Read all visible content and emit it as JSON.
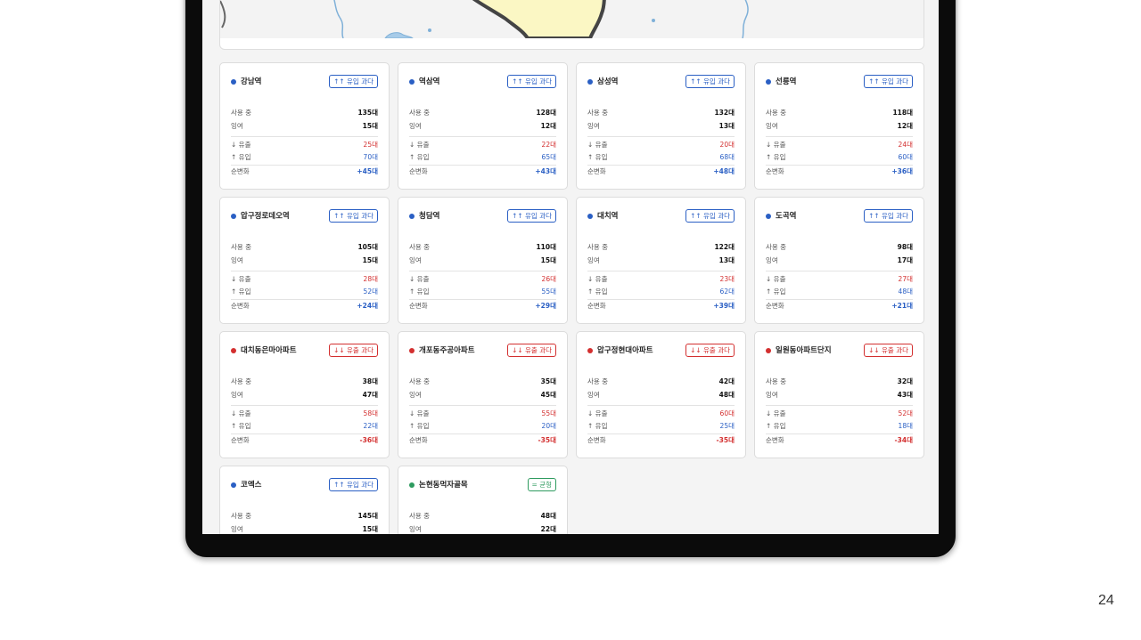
{
  "page_number": "24",
  "colors": {
    "inflow": "#2a5fc4",
    "outflow": "#d32f2f",
    "balanced": "#2e9b5f"
  },
  "labels": {
    "in_use": "사용 중",
    "spare": "잉여",
    "outflow": "↓ 유출",
    "inflow": "↑ 유입",
    "net": "순변화"
  },
  "stations": [
    {
      "name": "강남역",
      "status": "up",
      "badge": "↑↑ 유입 과다",
      "in_use": "135대",
      "spare": "15대",
      "outflow": "25대",
      "inflow": "70대",
      "net": "+45대"
    },
    {
      "name": "역삼역",
      "status": "up",
      "badge": "↑↑ 유입 과다",
      "in_use": "128대",
      "spare": "12대",
      "outflow": "22대",
      "inflow": "65대",
      "net": "+43대"
    },
    {
      "name": "삼성역",
      "status": "up",
      "badge": "↑↑ 유입 과다",
      "in_use": "132대",
      "spare": "13대",
      "outflow": "20대",
      "inflow": "68대",
      "net": "+48대"
    },
    {
      "name": "선릉역",
      "status": "up",
      "badge": "↑↑ 유입 과다",
      "in_use": "118대",
      "spare": "12대",
      "outflow": "24대",
      "inflow": "60대",
      "net": "+36대"
    },
    {
      "name": "압구정로데오역",
      "status": "up",
      "badge": "↑↑ 유입 과다",
      "in_use": "105대",
      "spare": "15대",
      "outflow": "28대",
      "inflow": "52대",
      "net": "+24대"
    },
    {
      "name": "청담역",
      "status": "up",
      "badge": "↑↑ 유입 과다",
      "in_use": "110대",
      "spare": "15대",
      "outflow": "26대",
      "inflow": "55대",
      "net": "+29대"
    },
    {
      "name": "대치역",
      "status": "up",
      "badge": "↑↑ 유입 과다",
      "in_use": "122대",
      "spare": "13대",
      "outflow": "23대",
      "inflow": "62대",
      "net": "+39대"
    },
    {
      "name": "도곡역",
      "status": "up",
      "badge": "↑↑ 유입 과다",
      "in_use": "98대",
      "spare": "17대",
      "outflow": "27대",
      "inflow": "48대",
      "net": "+21대"
    },
    {
      "name": "대치동은마아파트",
      "status": "down",
      "badge": "↓↓ 유출 과다",
      "in_use": "38대",
      "spare": "47대",
      "outflow": "58대",
      "inflow": "22대",
      "net": "-36대"
    },
    {
      "name": "개포동주공아파트",
      "status": "down",
      "badge": "↓↓ 유출 과다",
      "in_use": "35대",
      "spare": "45대",
      "outflow": "55대",
      "inflow": "20대",
      "net": "-35대"
    },
    {
      "name": "압구정현대아파트",
      "status": "down",
      "badge": "↓↓ 유출 과다",
      "in_use": "42대",
      "spare": "48대",
      "outflow": "60대",
      "inflow": "25대",
      "net": "-35대"
    },
    {
      "name": "일원동아파트단지",
      "status": "down",
      "badge": "↓↓ 유출 과다",
      "in_use": "32대",
      "spare": "43대",
      "outflow": "52대",
      "inflow": "18대",
      "net": "-34대"
    },
    {
      "name": "코엑스",
      "status": "up",
      "badge": "↑↑ 유입 과다",
      "in_use": "145대",
      "spare": "15대",
      "outflow": "",
      "inflow": "",
      "net": ""
    },
    {
      "name": "논현동먹자골목",
      "status": "balanced",
      "badge": "= 균형",
      "in_use": "48대",
      "spare": "22대",
      "outflow": "",
      "inflow": "",
      "net": ""
    }
  ]
}
